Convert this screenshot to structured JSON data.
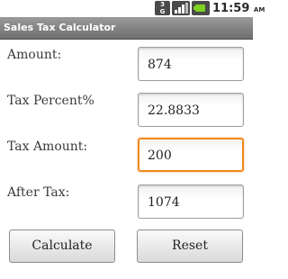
{
  "status_bar": {
    "network_label_top": "3",
    "network_label_bottom": "G",
    "network_icon": "3g-icon",
    "signal_icon": "signal-icon",
    "battery_icon": "battery-icon",
    "battery_color": "#7ed321",
    "time": "11:59",
    "ampm": "AM"
  },
  "title_bar": {
    "title": "Sales Tax Calculator"
  },
  "form": {
    "amount": {
      "label": "Amount:",
      "value": "874"
    },
    "tax_percent": {
      "label": "Tax Percent%",
      "value": "22.8833"
    },
    "tax_amount": {
      "label": "Tax Amount:",
      "value": "200"
    },
    "after_tax": {
      "label": "After Tax:",
      "value": "1074"
    }
  },
  "buttons": {
    "calculate_label": "Calculate",
    "reset_label": "Reset"
  },
  "colors": {
    "focus_border": "#f08a1c",
    "title_bar": "#7d7d7d"
  }
}
